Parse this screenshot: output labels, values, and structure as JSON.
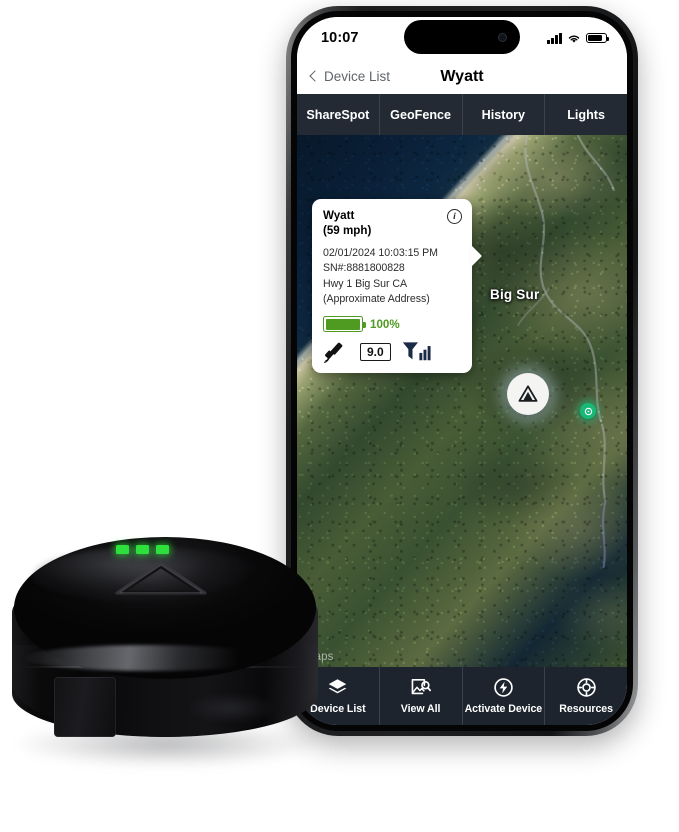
{
  "phone": {
    "statusbar": {
      "time": "10:07",
      "cellular_icon": "cellular-bars-icon",
      "wifi_icon": "wifi-icon",
      "battery_icon": "battery-icon"
    },
    "navbar": {
      "back_label": "Device List",
      "back_icon": "chevron-left-icon",
      "title": "Wyatt"
    },
    "tabs": [
      {
        "label": "ShareSpot"
      },
      {
        "label": "GeoFence"
      },
      {
        "label": "History"
      },
      {
        "label": "Lights"
      }
    ],
    "map": {
      "place_label": "Big Sur",
      "attribution": "Maps",
      "marker_icon": "device-triangle-marker-icon",
      "secondary_marker_icon": "green-location-pin-icon"
    },
    "info_card": {
      "device_name": "Wyatt",
      "speed": "(59 mph)",
      "timestamp": "02/01/2024 10:03:15 PM",
      "serial": "SN#:8881800828",
      "address": "Hwy 1 Big Sur CA",
      "address_note": "(Approximate Address)",
      "battery_percent": "100%",
      "battery_icon": "battery-full-icon",
      "satellite_icon": "satellite-icon",
      "hdop_value": "9.0",
      "signal_icon": "signal-bars-icon",
      "info_icon": "info-circle-icon",
      "info_glyph": "i"
    },
    "bottom_nav": [
      {
        "label": "Device List",
        "icon": "layers-stack-icon"
      },
      {
        "label": "View All",
        "icon": "image-search-icon"
      },
      {
        "label": "Activate Device",
        "icon": "power-bolt-circle-icon"
      },
      {
        "label": "Resources",
        "icon": "lifebuoy-target-icon"
      }
    ]
  },
  "device": {
    "name": "gps-tracker-puck",
    "led_count": 3,
    "logo_icon": "triangle-mountain-logo-icon"
  },
  "colors": {
    "tab_bar_bg": "#232a33",
    "bottom_nav_bg": "#1d242d",
    "battery_green": "#4f9a20",
    "led_green": "#2ee03c",
    "marker_green": "#18b877",
    "card_bg": "#ffffff",
    "ocean_blue": "#0d2740"
  }
}
